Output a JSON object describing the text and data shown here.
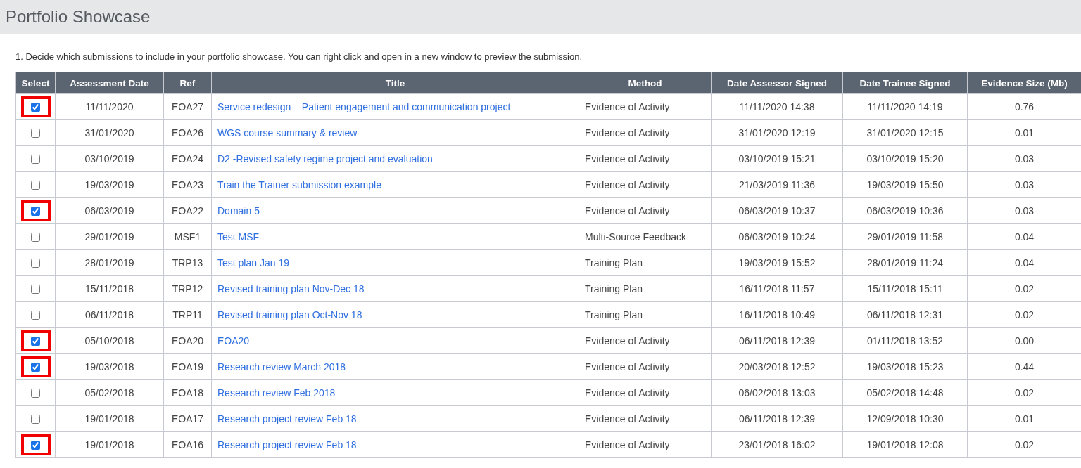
{
  "page_title": "Portfolio Showcase",
  "instruction": "1. Decide which submissions to include in your portfolio showcase. You can right click and open in a new window to preview the submission.",
  "table": {
    "columns": [
      "Select",
      "Assessment Date",
      "Ref",
      "Title",
      "Method",
      "Date Assessor Signed",
      "Date Trainee Signed",
      "Evidence Size (Mb)"
    ],
    "rows": [
      {
        "checked": true,
        "assessment_date": "11/11/2020",
        "ref": "EOA27",
        "title": "Service redesign – Patient engagement and communication project",
        "method": "Evidence of Activity",
        "date_assessor_signed": "11/11/2020 14:38",
        "date_trainee_signed": "11/11/2020 14:19",
        "evidence_size": "0.76"
      },
      {
        "checked": false,
        "assessment_date": "31/01/2020",
        "ref": "EOA26",
        "title": "WGS course summary & review",
        "method": "Evidence of Activity",
        "date_assessor_signed": "31/01/2020 12:19",
        "date_trainee_signed": "31/01/2020 12:15",
        "evidence_size": "0.01"
      },
      {
        "checked": false,
        "assessment_date": "03/10/2019",
        "ref": "EOA24",
        "title": "D2 -Revised safety regime project and evaluation",
        "method": "Evidence of Activity",
        "date_assessor_signed": "03/10/2019 15:21",
        "date_trainee_signed": "03/10/2019 15:20",
        "evidence_size": "0.03"
      },
      {
        "checked": false,
        "assessment_date": "19/03/2019",
        "ref": "EOA23",
        "title": "Train the Trainer submission example",
        "method": "Evidence of Activity",
        "date_assessor_signed": "21/03/2019 11:36",
        "date_trainee_signed": "19/03/2019 15:50",
        "evidence_size": "0.03"
      },
      {
        "checked": true,
        "assessment_date": "06/03/2019",
        "ref": "EOA22",
        "title": "Domain 5",
        "method": "Evidence of Activity",
        "date_assessor_signed": "06/03/2019 10:37",
        "date_trainee_signed": "06/03/2019 10:36",
        "evidence_size": "0.03"
      },
      {
        "checked": false,
        "assessment_date": "29/01/2019",
        "ref": "MSF1",
        "title": "Test MSF",
        "method": "Multi-Source Feedback",
        "date_assessor_signed": "06/03/2019 10:24",
        "date_trainee_signed": "29/01/2019 11:58",
        "evidence_size": "0.04"
      },
      {
        "checked": false,
        "assessment_date": "28/01/2019",
        "ref": "TRP13",
        "title": "Test plan Jan 19",
        "method": "Training Plan",
        "date_assessor_signed": "19/03/2019 15:52",
        "date_trainee_signed": "28/01/2019 11:24",
        "evidence_size": "0.04"
      },
      {
        "checked": false,
        "assessment_date": "15/11/2018",
        "ref": "TRP12",
        "title": "Revised training plan Nov-Dec 18",
        "method": "Training Plan",
        "date_assessor_signed": "16/11/2018 11:57",
        "date_trainee_signed": "15/11/2018 15:11",
        "evidence_size": "0.02"
      },
      {
        "checked": false,
        "assessment_date": "06/11/2018",
        "ref": "TRP11",
        "title": "Revised training plan Oct-Nov 18",
        "method": "Training Plan",
        "date_assessor_signed": "16/11/2018 10:49",
        "date_trainee_signed": "06/11/2018 12:31",
        "evidence_size": "0.02"
      },
      {
        "checked": true,
        "assessment_date": "05/10/2018",
        "ref": "EOA20",
        "title": "EOA20",
        "method": "Evidence of Activity",
        "date_assessor_signed": "06/11/2018 12:39",
        "date_trainee_signed": "01/11/2018 13:52",
        "evidence_size": "0.00"
      },
      {
        "checked": true,
        "assessment_date": "19/03/2018",
        "ref": "EOA19",
        "title": "Research review March 2018",
        "method": "Evidence of Activity",
        "date_assessor_signed": "20/03/2018 12:52",
        "date_trainee_signed": "19/03/2018 15:23",
        "evidence_size": "0.44"
      },
      {
        "checked": false,
        "assessment_date": "05/02/2018",
        "ref": "EOA18",
        "title": "Research review Feb 2018",
        "method": "Evidence of Activity",
        "date_assessor_signed": "06/02/2018 13:03",
        "date_trainee_signed": "05/02/2018 14:48",
        "evidence_size": "0.02"
      },
      {
        "checked": false,
        "assessment_date": "19/01/2018",
        "ref": "EOA17",
        "title": "Research project review Feb 18",
        "method": "Evidence of Activity",
        "date_assessor_signed": "06/11/2018 12:39",
        "date_trainee_signed": "12/09/2018 10:30",
        "evidence_size": "0.01"
      },
      {
        "checked": true,
        "assessment_date": "19/01/2018",
        "ref": "EOA16",
        "title": "Research project review Feb 18",
        "method": "Evidence of Activity",
        "date_assessor_signed": "23/01/2018 16:02",
        "date_trainee_signed": "19/01/2018 12:08",
        "evidence_size": "0.02"
      }
    ]
  }
}
